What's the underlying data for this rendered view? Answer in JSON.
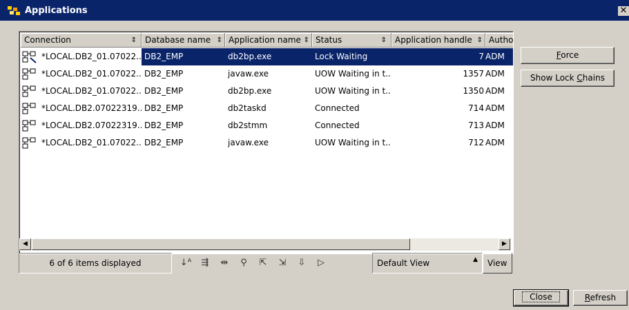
{
  "window": {
    "title": "Applications",
    "close_glyph": "✕"
  },
  "table": {
    "columns": [
      {
        "label": "Connection"
      },
      {
        "label": "Database name"
      },
      {
        "label": "Application name"
      },
      {
        "label": "Status"
      },
      {
        "label": "Application handle"
      },
      {
        "label": "Autho"
      }
    ],
    "sort_glyph": "⇕",
    "rows": [
      {
        "connection": "*LOCAL.DB2_01.07022...",
        "database": "DB2_EMP",
        "application": "db2bp.exe",
        "status": "Lock Waiting",
        "handle": "7",
        "auth": "ADM",
        "selected": true
      },
      {
        "connection": "*LOCAL.DB2_01.07022...",
        "database": "DB2_EMP",
        "application": "javaw.exe",
        "status": "UOW Waiting in t...",
        "handle": "1357",
        "auth": "ADM"
      },
      {
        "connection": "*LOCAL.DB2_01.07022...",
        "database": "DB2_EMP",
        "application": "db2bp.exe",
        "status": "UOW Waiting in t...",
        "handle": "1350",
        "auth": "ADM"
      },
      {
        "connection": "*LOCAL.DB2.07022319...",
        "database": "DB2_EMP",
        "application": "db2taskd",
        "status": "Connected",
        "handle": "714",
        "auth": "ADM"
      },
      {
        "connection": "*LOCAL.DB2.07022319...",
        "database": "DB2_EMP",
        "application": "db2stmm",
        "status": "Connected",
        "handle": "713",
        "auth": "ADM"
      },
      {
        "connection": "*LOCAL.DB2_01.07022...",
        "database": "DB2_EMP",
        "application": "javaw.exe",
        "status": "UOW Waiting in t...",
        "handle": "712",
        "auth": "ADM"
      }
    ]
  },
  "status_bar": {
    "items_text": "6 of 6 items displayed",
    "tools": [
      "sort-icon",
      "filter-icon",
      "columns-icon",
      "find-icon",
      "select-all-icon",
      "deselect-icon",
      "expand-icon",
      "collapse-icon"
    ],
    "tool_glyphs": [
      "↓ᴬ",
      "⇶",
      "⇹",
      "⚲",
      "⇱",
      "⇲",
      "⇩",
      "▷"
    ],
    "view_value": "Default View",
    "view_button": "View"
  },
  "buttons": {
    "force": {
      "pre": "",
      "ul": "F",
      "post": "orce"
    },
    "show_lock_chains": {
      "pre": "Show Lock ",
      "ul": "C",
      "post": "hains"
    },
    "close": "Close",
    "refresh": {
      "pre": "",
      "ul": "R",
      "post": "efresh"
    }
  }
}
